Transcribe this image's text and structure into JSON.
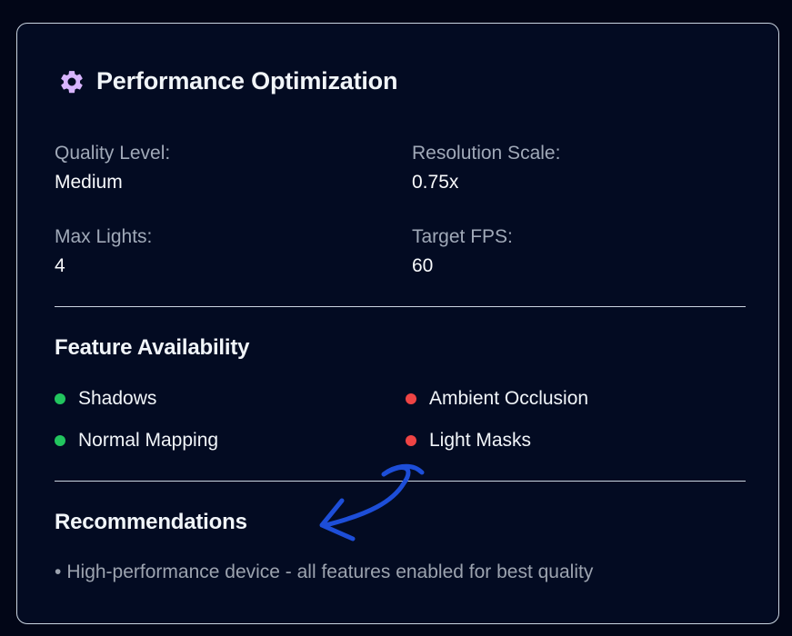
{
  "panel": {
    "title": "Performance Optimization",
    "icon": "gear-icon",
    "stats": [
      {
        "label": "Quality Level:",
        "value": "Medium"
      },
      {
        "label": "Resolution Scale:",
        "value": "0.75x"
      },
      {
        "label": "Max Lights:",
        "value": "4"
      },
      {
        "label": "Target FPS:",
        "value": "60"
      }
    ],
    "features": {
      "title": "Feature Availability",
      "items": [
        {
          "label": "Shadows",
          "status": "enabled",
          "color": "#22c55e"
        },
        {
          "label": "Ambient Occlusion",
          "status": "disabled",
          "color": "#ef4444"
        },
        {
          "label": "Normal Mapping",
          "status": "enabled",
          "color": "#22c55e"
        },
        {
          "label": "Light Masks",
          "status": "disabled",
          "color": "#ef4444"
        }
      ]
    },
    "recommendations": {
      "title": "Recommendations",
      "bullet": "•",
      "items": [
        "High-performance device - all features enabled for best quality"
      ]
    }
  },
  "annotation": {
    "icon": "curved-arrow-icon",
    "color": "#1d4ed8"
  }
}
